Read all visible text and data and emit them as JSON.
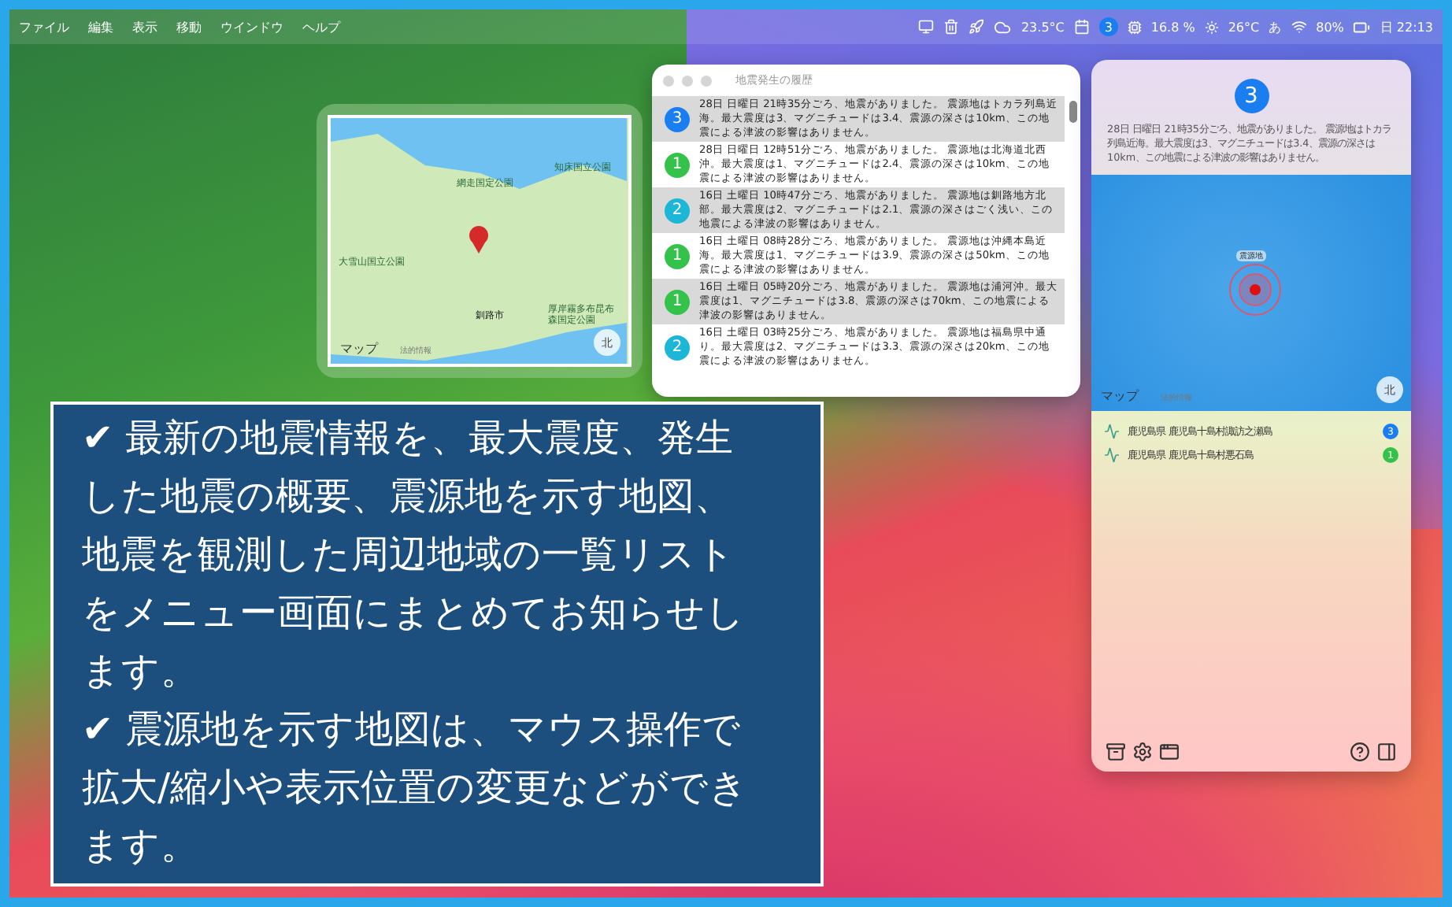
{
  "menubar": {
    "menus": [
      "ファイル",
      "編集",
      "表示",
      "移動",
      "ウインドウ",
      "ヘルプ"
    ],
    "status": {
      "temperature": "23.5°C",
      "badge": "3",
      "cpu": "16.8 %",
      "weather": "26°C",
      "input": "あ",
      "battery": "80%",
      "clock": "日 22:13"
    }
  },
  "map_popover": {
    "labels": [
      {
        "text": "網走国定公園",
        "kind": "park"
      },
      {
        "text": "知床国立公園",
        "kind": "park"
      },
      {
        "text": "大雪山国立公園",
        "kind": "park"
      },
      {
        "text": "釧路市",
        "kind": "city"
      },
      {
        "text": "厚岸霧多布昆布森国定公園",
        "kind": "park"
      }
    ],
    "brand": "マップ",
    "legal": "法的情報",
    "compass": "北"
  },
  "history": {
    "title": "地震発生の履歴",
    "rows": [
      {
        "intensity": "3",
        "color": "#1a7ef0",
        "text": "28日 日曜日 21時35分ごろ、地震がありました。 震源地はトカラ列島近海。最大震度は3、マグニチュードは3.4、震源の深さは10km、この地震による津波の影響はありません。"
      },
      {
        "intensity": "1",
        "color": "#34c24a",
        "text": "28日 日曜日 12時51分ごろ、地震がありました。 震源地は北海道北西沖。最大震度は1、マグニチュードは2.4、震源の深さは10km、この地震による津波の影響はありません。"
      },
      {
        "intensity": "2",
        "color": "#1cb6d6",
        "text": "16日 土曜日 10時47分ごろ、地震がありました。 震源地は釧路地方北部。最大震度は2、マグニチュードは2.1、震源の深さはごく浅い、この地震による津波の影響はありません。"
      },
      {
        "intensity": "1",
        "color": "#34c24a",
        "text": "16日 土曜日 08時28分ごろ、地震がありました。 震源地は沖縄本島近海。最大震度は1、マグニチュードは3.9、震源の深さは50km、この地震による津波の影響はありません。"
      },
      {
        "intensity": "1",
        "color": "#34c24a",
        "text": "16日 土曜日 05時20分ごろ、地震がありました。 震源地は浦河沖。最大震度は1、マグニチュードは3.8、震源の深さは70km、この地震による津波の影響はありません。"
      },
      {
        "intensity": "2",
        "color": "#1cb6d6",
        "text": "16日 土曜日 03時25分ごろ、地震がありました。 震源地は福島県中通り。最大震度は2、マグニチュードは3.3、震源の深さは20km、この地震による津波の影響はありません。"
      }
    ]
  },
  "detail_panel": {
    "intensity": "3",
    "color": "#1a7ef0",
    "summary": "28日 日曜日 21時35分ごろ、地震がありました。 震源地はトカラ列島近海。最大震度は3、マグニチュードは3.4、震源の深さは10km、この地震による津波の影響はありません。",
    "map": {
      "epicenter_label": "震源地",
      "brand": "マップ",
      "legal": "法的情報",
      "compass": "北"
    },
    "regions": [
      {
        "name": "鹿児島県 鹿児島十島村諏訪之瀬島",
        "intensity": "3",
        "color": "#1a7ef0"
      },
      {
        "name": "鹿児島県 鹿児島十島村悪石島",
        "intensity": "1",
        "color": "#34c24a"
      }
    ]
  },
  "caption": [
    "✔ 最新の地震情報を、最大震度、発生した地震の概要、震源地を示す地図、地震を観測した周辺地域の一覧リストをメニュー画面にまとめてお知らせします。",
    "✔ 震源地を示す地図は、マウス操作で拡大/縮小や表示位置の変更などができます。"
  ]
}
